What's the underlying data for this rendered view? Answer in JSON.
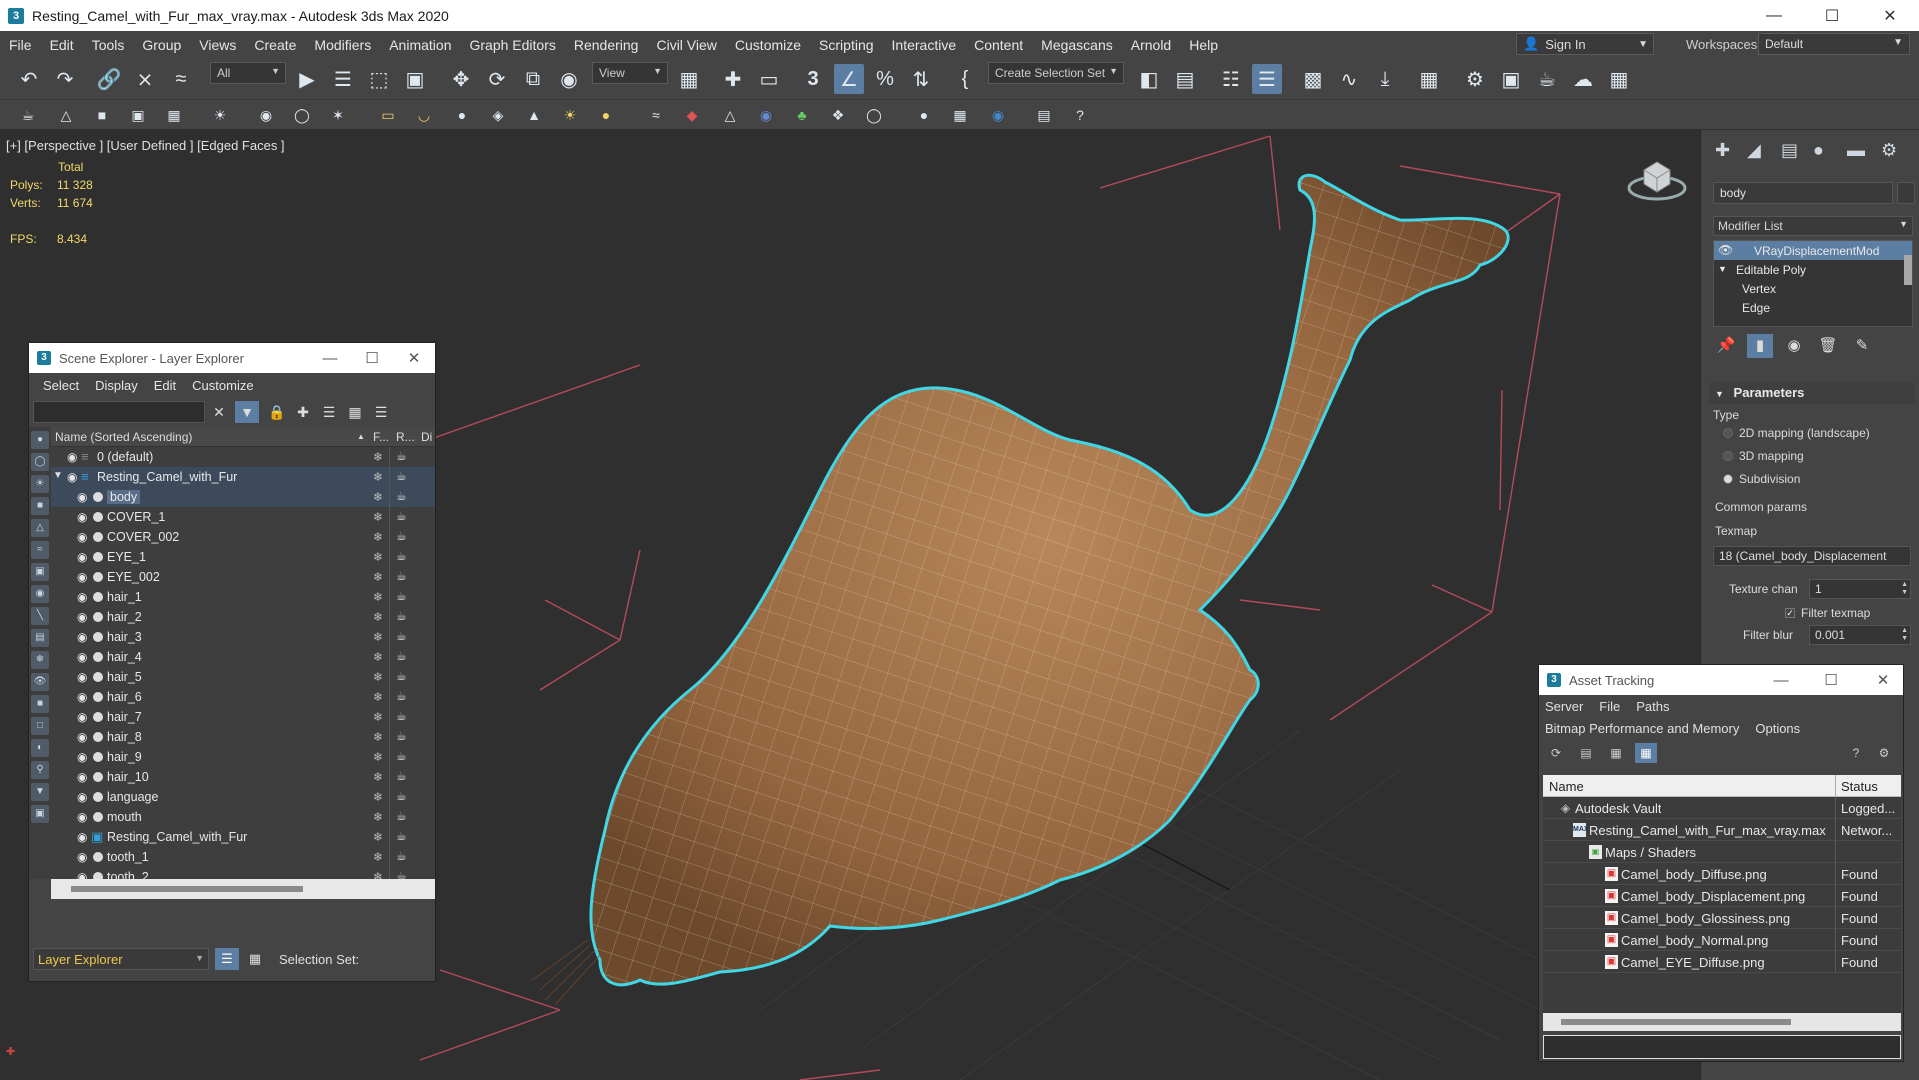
{
  "window": {
    "title": "Resting_Camel_with_Fur_max_vray.max - Autodesk 3ds Max 2020",
    "app_icon": "3"
  },
  "menu": [
    "File",
    "Edit",
    "Tools",
    "Group",
    "Views",
    "Create",
    "Modifiers",
    "Animation",
    "Graph Editors",
    "Rendering",
    "Civil View",
    "Customize",
    "Scripting",
    "Interactive",
    "Content",
    "Megascans",
    "Arnold",
    "Help"
  ],
  "account": {
    "sign_in": "Sign In",
    "workspaces_label": "Workspaces:",
    "workspace": "Default"
  },
  "toolbar": {
    "selection_filter": "All",
    "ref_coord": "View",
    "snap_label": "3",
    "selection_set": "Create Selection Set"
  },
  "viewport": {
    "label": "[+] [Perspective ] [User Defined ] [Edged Faces ]",
    "stats_total": "Total",
    "polys_label": "Polys:",
    "polys": "11 328",
    "verts_label": "Verts:",
    "verts": "11 674",
    "fps_label": "FPS:",
    "fps": "8.434"
  },
  "scene_explorer": {
    "title": "Scene Explorer - Layer Explorer",
    "menu": [
      "Select",
      "Display",
      "Edit",
      "Customize"
    ],
    "col_name": "Name (Sorted Ascending)",
    "col_f": "F...",
    "col_r": "R...",
    "col_d": "Di",
    "rows": [
      {
        "label": "0 (default)",
        "level": 0,
        "type": "layer"
      },
      {
        "label": "Resting_Camel_with_Fur",
        "level": 0,
        "type": "layer-active"
      },
      {
        "label": "body",
        "level": 1,
        "type": "object",
        "selected": true
      },
      {
        "label": "COVER_1",
        "level": 1,
        "type": "object"
      },
      {
        "label": "COVER_002",
        "level": 1,
        "type": "object"
      },
      {
        "label": "EYE_1",
        "level": 1,
        "type": "object"
      },
      {
        "label": "EYE_002",
        "level": 1,
        "type": "object"
      },
      {
        "label": "hair_1",
        "level": 1,
        "type": "object"
      },
      {
        "label": "hair_2",
        "level": 1,
        "type": "object"
      },
      {
        "label": "hair_3",
        "level": 1,
        "type": "object"
      },
      {
        "label": "hair_4",
        "level": 1,
        "type": "object"
      },
      {
        "label": "hair_5",
        "level": 1,
        "type": "object"
      },
      {
        "label": "hair_6",
        "level": 1,
        "type": "object"
      },
      {
        "label": "hair_7",
        "level": 1,
        "type": "object"
      },
      {
        "label": "hair_8",
        "level": 1,
        "type": "object"
      },
      {
        "label": "hair_9",
        "level": 1,
        "type": "object"
      },
      {
        "label": "hair_10",
        "level": 1,
        "type": "object"
      },
      {
        "label": "language",
        "level": 1,
        "type": "object"
      },
      {
        "label": "mouth",
        "level": 1,
        "type": "object"
      },
      {
        "label": "Resting_Camel_with_Fur",
        "level": 1,
        "type": "group"
      },
      {
        "label": "tooth_1",
        "level": 1,
        "type": "object"
      },
      {
        "label": "tooth_2",
        "level": 1,
        "type": "object"
      }
    ],
    "footer_explorer": "Layer Explorer",
    "footer_selection_set": "Selection Set:"
  },
  "command_panel": {
    "object_name": "body",
    "modifier_list": "Modifier List",
    "stack": [
      {
        "label": "VRayDisplacementMod",
        "selected": true
      },
      {
        "label": "Editable Poly"
      },
      {
        "label": "Vertex"
      },
      {
        "label": "Edge"
      }
    ],
    "parameters_title": "Parameters",
    "type_label": "Type",
    "radio_2d": "2D mapping (landscape)",
    "radio_3d": "3D mapping",
    "radio_sub": "Subdivision",
    "common_params": "Common params",
    "texmap_label": "Texmap",
    "texmap_value": "18 (Camel_body_Displacement",
    "texture_chan_label": "Texture chan",
    "texture_chan_value": "1",
    "filter_texmap": "Filter texmap",
    "filter_blur_label": "Filter blur",
    "filter_blur_value": "0.001"
  },
  "asset_tracking": {
    "title": "Asset Tracking",
    "menu1": [
      "Server",
      "File",
      "Paths"
    ],
    "menu2": [
      "Bitmap Performance and Memory",
      "Options"
    ],
    "col_name": "Name",
    "col_status": "Status",
    "rows": [
      {
        "name": "Autodesk Vault",
        "status": "Logged...",
        "indent": 16,
        "icon": "vault"
      },
      {
        "name": "Resting_Camel_with_Fur_max_vray.max",
        "status": "Networ...",
        "indent": 30,
        "icon": "max"
      },
      {
        "name": "Maps / Shaders",
        "status": "",
        "indent": 46,
        "icon": "folder"
      },
      {
        "name": "Camel_body_Diffuse.png",
        "status": "Found",
        "indent": 62,
        "icon": "png"
      },
      {
        "name": "Camel_body_Displacement.png",
        "status": "Found",
        "indent": 62,
        "icon": "png"
      },
      {
        "name": "Camel_body_Glossiness.png",
        "status": "Found",
        "indent": 62,
        "icon": "png"
      },
      {
        "name": "Camel_body_Normal.png",
        "status": "Found",
        "indent": 62,
        "icon": "png"
      },
      {
        "name": "Camel_EYE_Diffuse.png",
        "status": "Found",
        "indent": 62,
        "icon": "png"
      }
    ]
  },
  "colors": {
    "ui_bg": "#444444",
    "viewport_bg": "#2f2f2f",
    "selection_blue": "#5d7ea3",
    "stats_yellow": "#f2d96a",
    "outline_cyan": "#3fd6e6",
    "camel_tan": "#a9794d"
  }
}
